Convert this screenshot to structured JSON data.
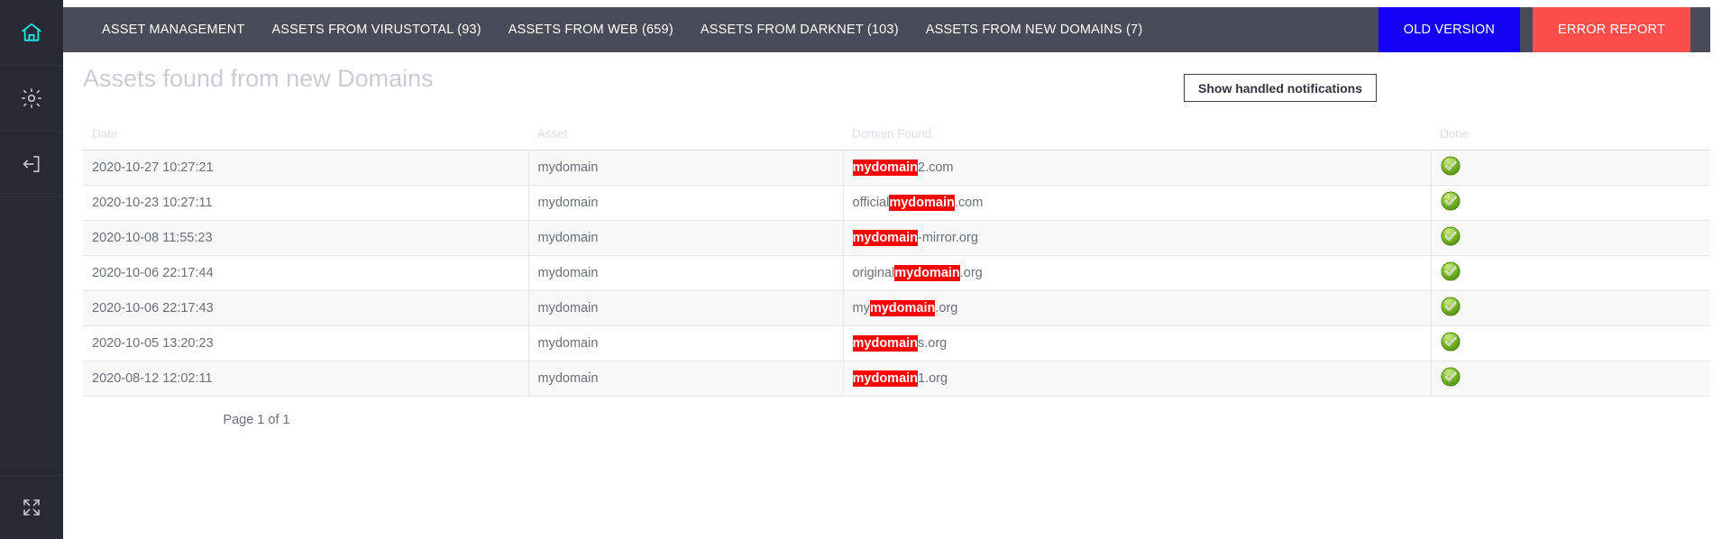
{
  "sidebar": {
    "items": [
      {
        "icon": "home-icon",
        "name": "sidebar-item-home",
        "active": true
      },
      {
        "icon": "gear-icon",
        "name": "sidebar-item-settings",
        "active": false
      },
      {
        "icon": "logout-icon",
        "name": "sidebar-item-logout",
        "active": false
      }
    ],
    "bottom": {
      "icon": "expand-icon",
      "name": "sidebar-item-expand"
    },
    "active_color": "#1ee6e0",
    "icon_color": "#c3c6ce",
    "background": "#272a35"
  },
  "navbar": {
    "background": "#484b58",
    "links": [
      {
        "label": "ASSET MANAGEMENT"
      },
      {
        "label": "ASSETS FROM VIRUSTOTAL (93)"
      },
      {
        "label": "ASSETS FROM WEB (659)"
      },
      {
        "label": "ASSETS FROM DARKNET (103)"
      },
      {
        "label": "ASSETS FROM NEW DOMAINS (7)"
      }
    ],
    "old_version_label": "OLD VERSION",
    "old_version_color": "#1300f5",
    "error_report_label": "ERROR REPORT",
    "error_report_color": "#fc4f4b"
  },
  "page": {
    "title": "Assets found from new Domains",
    "title_color": "#c9ccd4",
    "show_handled_label": "Show handled notifications"
  },
  "table": {
    "columns": [
      "Date",
      "Asset",
      "Domain Found",
      "Done"
    ],
    "highlight_term": "mydomain",
    "highlight_color": "#fe0000",
    "rows": [
      {
        "date": "2020-10-27 10:27:21",
        "asset": "mydomain",
        "domain_prefix": "",
        "domain_match": "mydomain",
        "domain_suffix": "2.com",
        "done": "check-green"
      },
      {
        "date": "2020-10-23 10:27:11",
        "asset": "mydomain",
        "domain_prefix": "official",
        "domain_match": "mydomain",
        "domain_suffix": ".com",
        "done": "check-green"
      },
      {
        "date": "2020-10-08 11:55:23",
        "asset": "mydomain",
        "domain_prefix": "",
        "domain_match": "mydomain",
        "domain_suffix": "-mirror.org",
        "done": "check-green"
      },
      {
        "date": "2020-10-06 22:17:44",
        "asset": "mydomain",
        "domain_prefix": "original",
        "domain_match": "mydomain",
        "domain_suffix": ".org",
        "done": "check-green"
      },
      {
        "date": "2020-10-06 22:17:43",
        "asset": "mydomain",
        "domain_prefix": "my",
        "domain_match": "mydomain",
        "domain_suffix": ".org",
        "done": "check-green"
      },
      {
        "date": "2020-10-05 13:20:23",
        "asset": "mydomain",
        "domain_prefix": "",
        "domain_match": "mydomain",
        "domain_suffix": "s.org",
        "done": "check-green"
      },
      {
        "date": "2020-08-12 12:02:11",
        "asset": "mydomain",
        "domain_prefix": "",
        "domain_match": "mydomain",
        "domain_suffix": "1.org",
        "done": "check-green"
      }
    ]
  },
  "pagination": {
    "label": "Page 1 of 1"
  }
}
